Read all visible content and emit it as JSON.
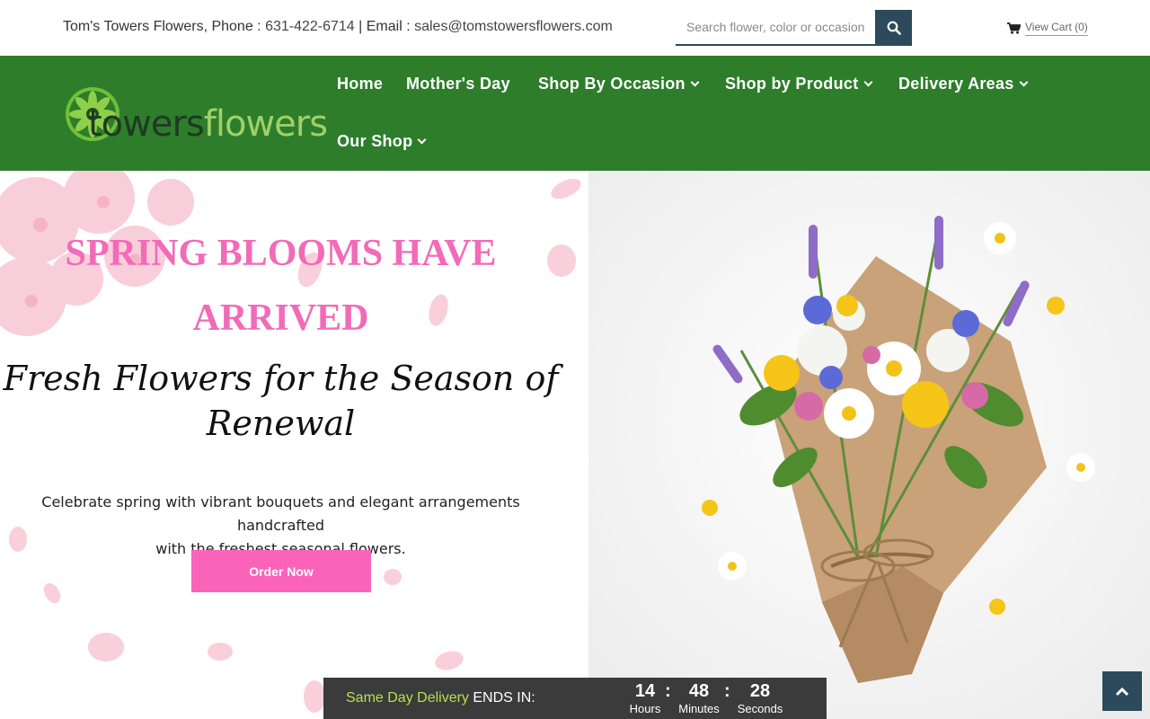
{
  "topbar": {
    "store_name": "Tom's Towers Flowers, Phone : ",
    "phone": "631-422-6714",
    "email_prefix": " | Email : ",
    "email": "sales@tomstowersflowers.com",
    "search_placeholder": "Search flower, color or occasion",
    "cart_label": "View Cart (0)"
  },
  "logo": {
    "part1": "towers",
    "part2": "flowers"
  },
  "nav": {
    "items": [
      {
        "label": "Home",
        "dropdown": false
      },
      {
        "label": "Mother's Day",
        "dropdown": false
      },
      {
        "label": "Shop By Occasion",
        "dropdown": true
      },
      {
        "label": "Shop by Product",
        "dropdown": true
      },
      {
        "label": "Delivery Areas",
        "dropdown": true
      },
      {
        "label": "Our Shop",
        "dropdown": true
      }
    ]
  },
  "hero": {
    "headline_line1": "SPRING BLOOMS HAVE",
    "headline_line2": "ARRIVED",
    "script_line1": "Fresh Flowers for the Season of",
    "script_line2": "Renewal",
    "description_line1": "Celebrate spring with vibrant bouquets and elegant arrangements handcrafted",
    "description_line2": "with the freshest seasonal flowers.",
    "cta": "Order Now"
  },
  "countdown": {
    "highlight": "Same Day Delivery",
    "suffix": " ENDS IN:",
    "hours": "14",
    "minutes": "48",
    "seconds": "28",
    "hours_label": "Hours",
    "minutes_label": "Minutes",
    "seconds_label": "Seconds",
    "separator": ":"
  },
  "colors": {
    "nav_green": "#2e7d2b",
    "headline_pink": "#f26ab8",
    "button_pink": "#fb63b9",
    "dark_slate": "#2d4a5c",
    "countdown_bg": "#3b3b3b",
    "countdown_highlight": "#b8e04a"
  },
  "icons": {
    "search": "search-icon",
    "cart": "cart-icon",
    "logo": "mandala-logo-icon",
    "back_to_top": "chevron-up-icon"
  }
}
